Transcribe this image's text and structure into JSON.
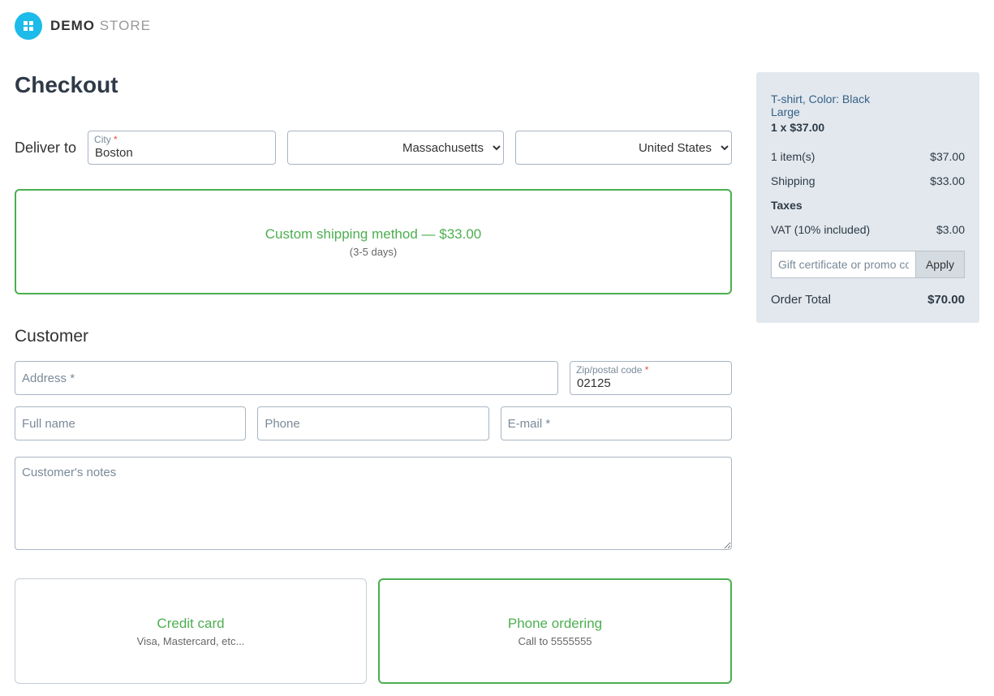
{
  "brand": {
    "strong": "DEMO",
    "light": " STORE"
  },
  "title": "Checkout",
  "deliver": {
    "label": "Deliver to",
    "city_label": "City",
    "city_value": "Boston",
    "state": "Massachusetts",
    "country": "United States"
  },
  "shipping": {
    "title": "Custom shipping method — $33.00",
    "sub": "(3-5 days)"
  },
  "customer": {
    "heading": "Customer",
    "address_label": "Address",
    "address_value": "",
    "zip_label": "Zip/postal code",
    "zip_value": "02125",
    "fullname_ph": "Full name",
    "phone_ph": "Phone",
    "email_label": "E-mail",
    "notes_ph": "Customer's notes"
  },
  "payment": {
    "credit": {
      "title": "Credit card",
      "sub": "Visa, Mastercard, etc..."
    },
    "phone": {
      "title": "Phone ordering",
      "sub": "Call to 5555555"
    }
  },
  "cart": {
    "item_line1": "T-shirt, Color: Black",
    "item_line2": "Large",
    "item_qty": "1 x $37.00",
    "items_label": "1 item(s)",
    "items_value": "$37.00",
    "ship_label": "Shipping",
    "ship_value": "$33.00",
    "tax_header": "Taxes",
    "vat_label": "VAT (10% included)",
    "vat_value": "$3.00",
    "promo_ph": "Gift certificate or promo code",
    "apply": "Apply",
    "total_label": "Order Total",
    "total_value": "$70.00"
  }
}
